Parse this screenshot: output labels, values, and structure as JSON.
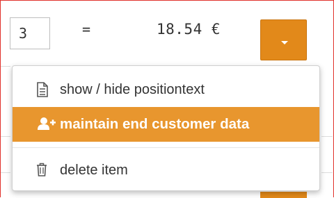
{
  "row": {
    "quantity": "3",
    "equals": "=",
    "price": "18.54 €"
  },
  "dropdown": {
    "toggle_icon": "chevron-down-icon"
  },
  "menu": {
    "items": [
      {
        "label": "show / hide positiontext",
        "icon": "document-icon"
      },
      {
        "label": "maintain end customer data",
        "icon": "add-user-icon"
      },
      {
        "label": "delete item",
        "icon": "trash-icon"
      }
    ]
  },
  "colors": {
    "accent": "#e2891a",
    "highlight": "#e8962e",
    "border_red": "#e0312b"
  }
}
